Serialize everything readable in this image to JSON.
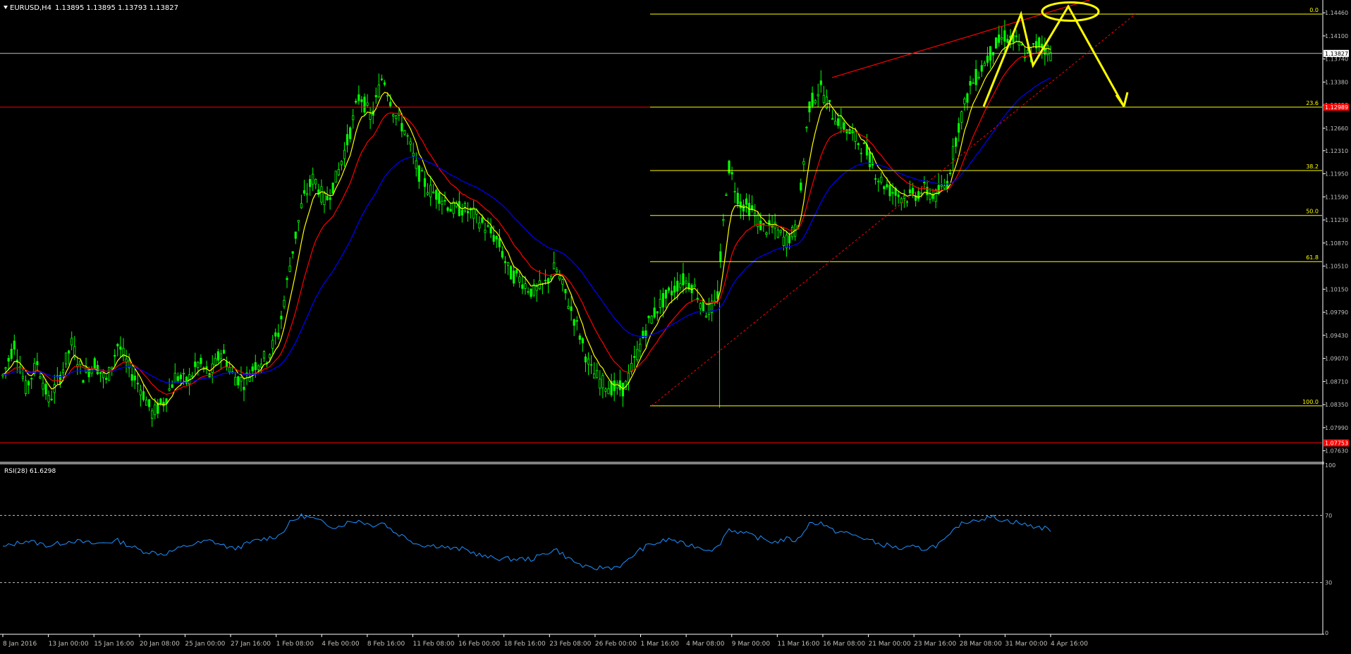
{
  "header": {
    "symbol_label": "EURUSD,H4",
    "ohlc": "1.13895 1.13895 1.13793 1.13827",
    "menu_icon": "triangle-down-icon"
  },
  "colors": {
    "background": "#000000",
    "candle_up": "#00ff00",
    "candle_down": "#00ff00",
    "ma_fast": "#ffff00",
    "ma_mid": "#ff0000",
    "ma_slow": "#0000ff",
    "fib": "#ffff00",
    "red_line": "#ff0000",
    "rsi": "#1e90ff",
    "axis_text": "#c0c0c0",
    "annotation": "#ffff00"
  },
  "chart_data": [
    {
      "type": "candlestick",
      "title": "EURUSD,H4",
      "y_ticks": [
        "1.14460",
        "1.14100",
        "1.13740",
        "1.13380",
        "1.13020",
        "1.12660",
        "1.12310",
        "1.11950",
        "1.11590",
        "1.11230",
        "1.10870",
        "1.10510",
        "1.10150",
        "1.09790",
        "1.09430",
        "1.09070",
        "1.08710",
        "1.08350",
        "1.07990",
        "1.07630"
      ],
      "ylim": [
        1.0745,
        1.1466
      ],
      "current_price_label": "1.13827",
      "current_price": 1.13827,
      "hline_upper_label": "1.12989",
      "hline_upper": 1.12989,
      "hline_lower_label": "1.07753",
      "hline_lower": 1.07753,
      "x_ticks": [
        "8 Jan 2016",
        "13 Jan 00:00",
        "15 Jan 16:00",
        "20 Jan 08:00",
        "25 Jan 00:00",
        "27 Jan 16:00",
        "1 Feb 08:00",
        "4 Feb 00:00",
        "8 Feb 16:00",
        "11 Feb 08:00",
        "16 Feb 00:00",
        "18 Feb 16:00",
        "23 Feb 08:00",
        "26 Feb 00:00",
        "1 Mar 16:00",
        "4 Mar 08:00",
        "9 Mar 00:00",
        "11 Mar 16:00",
        "16 Mar 08:00",
        "21 Mar 00:00",
        "23 Mar 16:00",
        "28 Mar 08:00",
        "31 Mar 00:00",
        "4 Apr 16:00"
      ],
      "price_path": [
        [
          0,
          1.088
        ],
        [
          2,
          1.093
        ],
        [
          4,
          1.086
        ],
        [
          6,
          1.09
        ],
        [
          8,
          1.084
        ],
        [
          10,
          1.088
        ],
        [
          12,
          1.093
        ],
        [
          14,
          1.088
        ],
        [
          16,
          1.09
        ],
        [
          18,
          1.087
        ],
        [
          20,
          1.093
        ],
        [
          22,
          1.089
        ],
        [
          24,
          1.086
        ],
        [
          26,
          1.082
        ],
        [
          28,
          1.084
        ],
        [
          30,
          1.088
        ],
        [
          32,
          1.087
        ],
        [
          34,
          1.09
        ],
        [
          36,
          1.088
        ],
        [
          38,
          1.092
        ],
        [
          40,
          1.088
        ],
        [
          42,
          1.087
        ],
        [
          44,
          1.09
        ],
        [
          46,
          1.091
        ],
        [
          48,
          1.095
        ],
        [
          50,
          1.106
        ],
        [
          52,
          1.115
        ],
        [
          54,
          1.119
        ],
        [
          56,
          1.115
        ],
        [
          58,
          1.119
        ],
        [
          60,
          1.125
        ],
        [
          62,
          1.132
        ],
        [
          64,
          1.128
        ],
        [
          66,
          1.135
        ],
        [
          68,
          1.129
        ],
        [
          70,
          1.126
        ],
        [
          72,
          1.12
        ],
        [
          74,
          1.117
        ],
        [
          76,
          1.116
        ],
        [
          78,
          1.114
        ],
        [
          80,
          1.114
        ],
        [
          82,
          1.113
        ],
        [
          84,
          1.111
        ],
        [
          86,
          1.109
        ],
        [
          88,
          1.104
        ],
        [
          90,
          1.103
        ],
        [
          92,
          1.101
        ],
        [
          94,
          1.102
        ],
        [
          96,
          1.105
        ],
        [
          98,
          1.1
        ],
        [
          100,
          1.095
        ],
        [
          102,
          1.089
        ],
        [
          104,
          1.087
        ],
        [
          106,
          1.086
        ],
        [
          108,
          1.086
        ],
        [
          110,
          1.091
        ],
        [
          112,
          1.096
        ],
        [
          114,
          1.099
        ],
        [
          116,
          1.101
        ],
        [
          118,
          1.103
        ],
        [
          120,
          1.102
        ],
        [
          122,
          1.098
        ],
        [
          124,
          1.099
        ],
        [
          126,
          1.121
        ],
        [
          128,
          1.115
        ],
        [
          130,
          1.114
        ],
        [
          132,
          1.111
        ],
        [
          134,
          1.111
        ],
        [
          136,
          1.109
        ],
        [
          138,
          1.111
        ],
        [
          140,
          1.13
        ],
        [
          142,
          1.133
        ],
        [
          144,
          1.129
        ],
        [
          146,
          1.127
        ],
        [
          148,
          1.125
        ],
        [
          150,
          1.123
        ],
        [
          152,
          1.119
        ],
        [
          154,
          1.117
        ],
        [
          156,
          1.116
        ],
        [
          158,
          1.116
        ],
        [
          160,
          1.117
        ],
        [
          162,
          1.116
        ],
        [
          164,
          1.118
        ],
        [
          166,
          1.127
        ],
        [
          168,
          1.133
        ],
        [
          170,
          1.136
        ],
        [
          172,
          1.139
        ],
        [
          174,
          1.141
        ],
        [
          176,
          1.14
        ],
        [
          178,
          1.138
        ],
        [
          180,
          1.14
        ],
        [
          182,
          1.1383
        ]
      ],
      "series": [
        {
          "name": "MA fast",
          "color": "#ffff00"
        },
        {
          "name": "MA mid",
          "color": "#ff0000"
        },
        {
          "name": "MA slow",
          "color": "#0000ff"
        }
      ],
      "fibonacci": [
        {
          "label": "0.0",
          "price": 1.1444
        },
        {
          "label": "23.6",
          "price": 1.12989
        },
        {
          "label": "38.2",
          "price": 1.12
        },
        {
          "label": "50.0",
          "price": 1.113
        },
        {
          "label": "61.8",
          "price": 1.1058
        },
        {
          "label": "100.0",
          "price": 1.0833
        }
      ]
    },
    {
      "type": "line",
      "title": "RSI(28) 61.6298",
      "label": "RSI(28) 61.6298",
      "ylim": [
        0,
        100
      ],
      "y_ticks": [
        "100",
        "70",
        "30",
        "0"
      ],
      "levels": [
        70,
        30
      ],
      "rsi_path": [
        [
          0,
          51
        ],
        [
          4,
          55
        ],
        [
          8,
          52
        ],
        [
          12,
          55
        ],
        [
          16,
          53
        ],
        [
          20,
          55
        ],
        [
          24,
          49
        ],
        [
          28,
          47
        ],
        [
          32,
          52
        ],
        [
          36,
          55
        ],
        [
          40,
          50
        ],
        [
          44,
          55
        ],
        [
          48,
          58
        ],
        [
          50,
          66
        ],
        [
          52,
          70
        ],
        [
          54,
          68
        ],
        [
          56,
          65
        ],
        [
          58,
          63
        ],
        [
          60,
          66
        ],
        [
          62,
          67
        ],
        [
          64,
          64
        ],
        [
          66,
          66
        ],
        [
          68,
          60
        ],
        [
          70,
          57
        ],
        [
          72,
          53
        ],
        [
          74,
          52
        ],
        [
          76,
          52
        ],
        [
          78,
          50
        ],
        [
          80,
          50
        ],
        [
          84,
          45
        ],
        [
          88,
          44
        ],
        [
          92,
          44
        ],
        [
          94,
          47
        ],
        [
          96,
          50
        ],
        [
          98,
          45
        ],
        [
          100,
          41
        ],
        [
          102,
          38
        ],
        [
          104,
          39
        ],
        [
          106,
          39
        ],
        [
          108,
          41
        ],
        [
          110,
          48
        ],
        [
          112,
          52
        ],
        [
          114,
          54
        ],
        [
          116,
          56
        ],
        [
          118,
          53
        ],
        [
          120,
          52
        ],
        [
          122,
          50
        ],
        [
          124,
          50
        ],
        [
          126,
          62
        ],
        [
          128,
          60
        ],
        [
          130,
          58
        ],
        [
          132,
          56
        ],
        [
          134,
          54
        ],
        [
          136,
          56
        ],
        [
          138,
          55
        ],
        [
          140,
          65
        ],
        [
          142,
          66
        ],
        [
          144,
          61
        ],
        [
          146,
          60
        ],
        [
          148,
          58
        ],
        [
          150,
          56
        ],
        [
          152,
          53
        ],
        [
          154,
          52
        ],
        [
          156,
          50
        ],
        [
          158,
          51
        ],
        [
          160,
          50
        ],
        [
          162,
          52
        ],
        [
          164,
          56
        ],
        [
          166,
          64
        ],
        [
          168,
          67
        ],
        [
          170,
          68
        ],
        [
          172,
          69
        ],
        [
          174,
          67
        ],
        [
          176,
          66
        ],
        [
          178,
          64
        ],
        [
          180,
          63
        ],
        [
          182,
          61.6298
        ]
      ]
    }
  ]
}
